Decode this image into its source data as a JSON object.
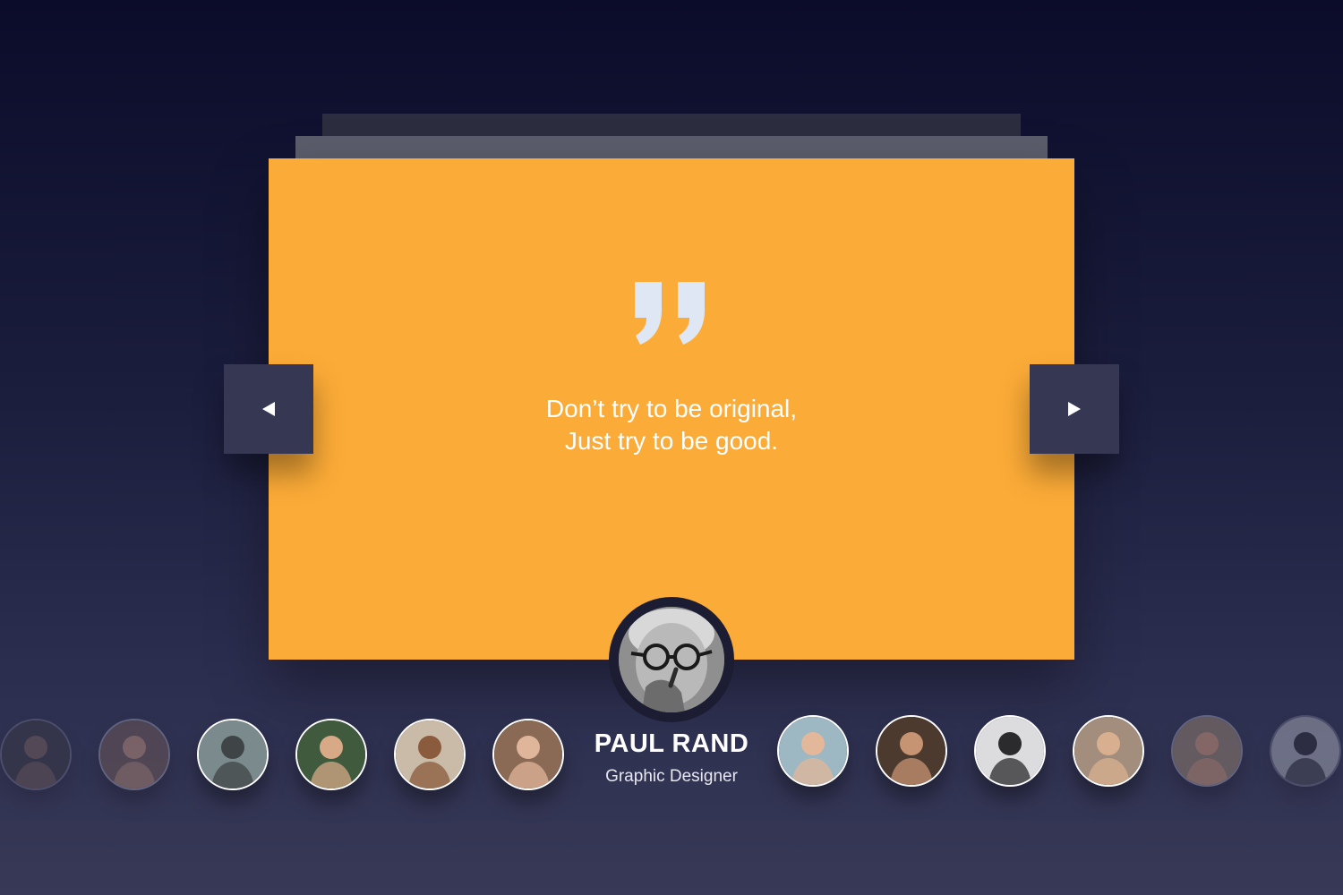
{
  "testimonial": {
    "quote_lines": [
      "Don’t try to be original,",
      "Just try to be good."
    ],
    "author_name": "PAUL RAND",
    "author_role": "Graphic Designer"
  },
  "navigation": {
    "prev_icon": "triangle-left-icon",
    "next_icon": "triangle-right-icon"
  },
  "thumbnails": [
    {
      "name": "avatar-thumb-1",
      "bg": "#3d3a3e",
      "skin": "#8d6e5e"
    },
    {
      "name": "avatar-thumb-2",
      "bg": "#6a5656",
      "skin": "#b58b7a"
    },
    {
      "name": "avatar-thumb-3",
      "bg": "#7b8a8c",
      "skin": "#3f4447"
    },
    {
      "name": "avatar-thumb-4",
      "bg": "#3f5a3c",
      "skin": "#d7a987"
    },
    {
      "name": "avatar-thumb-5",
      "bg": "#c9bba7",
      "skin": "#8a5b3c"
    },
    {
      "name": "avatar-thumb-6",
      "bg": "#8a6a55",
      "skin": "#e0b69a"
    },
    {
      "name": "avatar-thumb-7",
      "bg": "#9db7c3",
      "skin": "#e2b79a"
    },
    {
      "name": "avatar-thumb-8",
      "bg": "#4d3a2e",
      "skin": "#c69373"
    },
    {
      "name": "avatar-thumb-9",
      "bg": "#dcdcde",
      "skin": "#2b2b2e"
    },
    {
      "name": "avatar-thumb-10",
      "bg": "#a38e7e",
      "skin": "#d9b08f"
    },
    {
      "name": "avatar-thumb-11",
      "bg": "#8f7d6e",
      "skin": "#c99277"
    },
    {
      "name": "avatar-thumb-12",
      "bg": "#cfd3d8",
      "skin": "#26272a"
    }
  ],
  "colors": {
    "card": "#fbab37",
    "nav_button": "#363853",
    "quote_mark": "#dfe6f4"
  }
}
